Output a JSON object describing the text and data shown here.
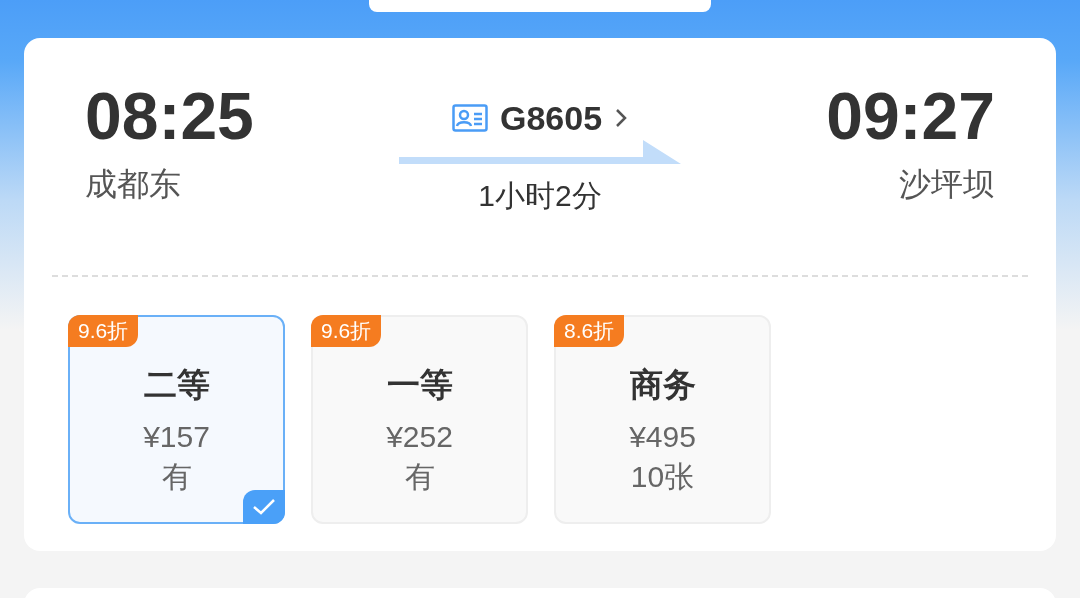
{
  "train": {
    "depart_time": "08:25",
    "depart_station": "成都东",
    "number": "G8605",
    "duration": "1小时2分",
    "arrive_time": "09:27",
    "arrive_station": "沙坪坝"
  },
  "seats": [
    {
      "discount": "9.6折",
      "name": "二等",
      "price": "¥157",
      "availability": "有",
      "selected": true
    },
    {
      "discount": "9.6折",
      "name": "一等",
      "price": "¥252",
      "availability": "有",
      "selected": false
    },
    {
      "discount": "8.6折",
      "name": "商务",
      "price": "¥495",
      "availability": "10张",
      "selected": false
    }
  ]
}
